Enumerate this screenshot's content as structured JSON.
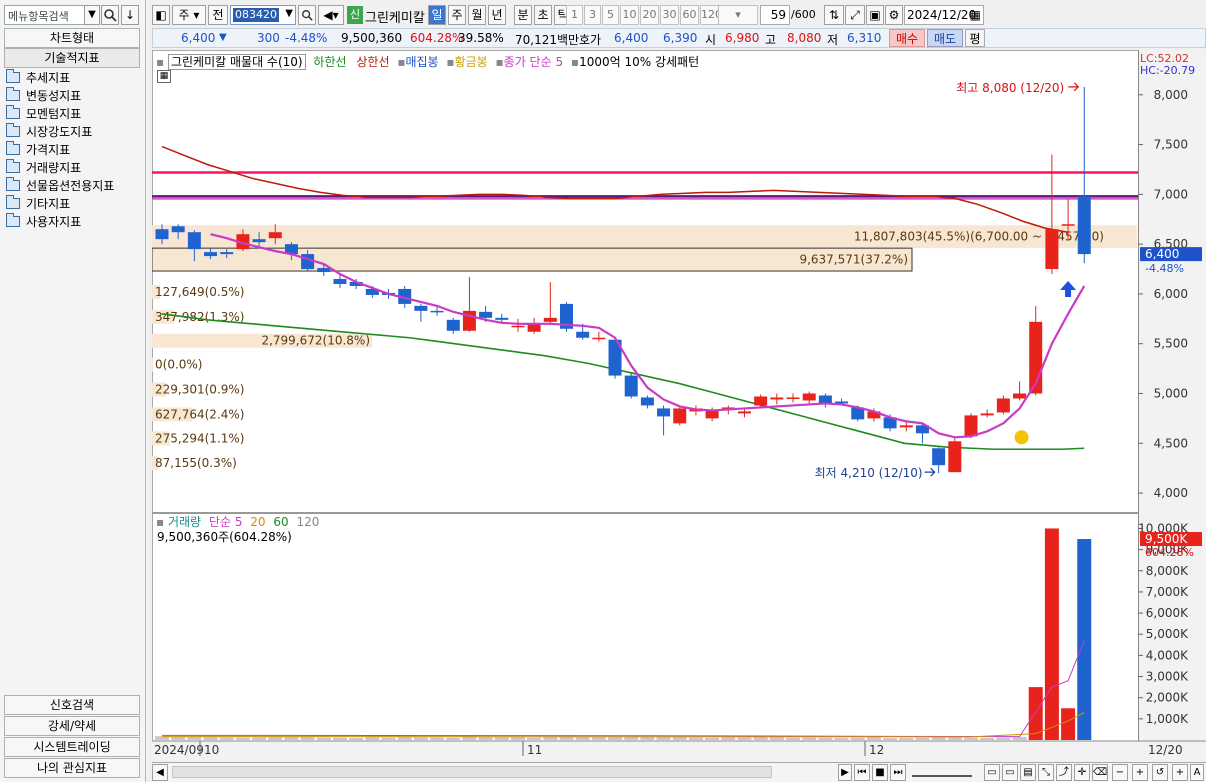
{
  "left_panel": {
    "search_placeholder": "메뉴항목검색",
    "chart_type_label": "차트형태",
    "tech_indicator_label": "기술적지표",
    "tree": [
      "추세지표",
      "변동성지표",
      "모멘텀지표",
      "시장강도지표",
      "가격지표",
      "거래량지표",
      "선물옵션전용지표",
      "기타지표",
      "사용자지표"
    ],
    "bottom_buttons": [
      "신호검색",
      "강세/약세",
      "시스템트레이딩",
      "나의 관심지표"
    ]
  },
  "toolbar": {
    "mode_label": "주",
    "prev_label": "전",
    "code_value": "083420",
    "credit_badge": "신",
    "stock_name": "그린케미칼",
    "periods": [
      "일",
      "주",
      "월",
      "년",
      "분",
      "초",
      "틱"
    ],
    "active_period": "일",
    "intervals": [
      "1",
      "3",
      "5",
      "10",
      "20",
      "30",
      "60",
      "120"
    ],
    "count_value": "59",
    "count_total": "/600",
    "date_value": "2024/12/20"
  },
  "quote": {
    "price": "6,400",
    "change": "300",
    "change_pct": "-4.48%",
    "volume": "9,500,360",
    "volume_pct": "604.28%",
    "turnover": "39.58%",
    "amount": "70,121백만",
    "bid_label": "호가",
    "ask": "6,400",
    "bid": "6,390",
    "open_label": "시",
    "open": "6,980",
    "high_label": "고",
    "high": "8,080",
    "low_label": "저",
    "low": "6,310",
    "buy_label": "매수",
    "sell_label": "매도",
    "avg_label": "평"
  },
  "price_legend": {
    "item1": "그린케미칼 매물대 수(10)",
    "item2": "하한선",
    "item3": "상한선",
    "item4": "매집봉",
    "item5": "황금봉",
    "item6": "종가 단순 5",
    "item7": "1000억 10% 강세패턴"
  },
  "lc_hc": {
    "lc": "LC:52.02",
    "hc": "HC:-20.79"
  },
  "volume_profile": [
    "11,807,803(45.5%)(6,700.00 ~ 6,457.50)",
    "9,637,571(37.2%)",
    "127,649(0.5%)",
    "347,982(1.3%)",
    "2,799,672(10.8%)",
    "0(0.0%)",
    "229,301(0.9%)",
    "627,764(2.4%)",
    "275,294(1.1%)",
    "87,155(0.3%)"
  ],
  "annotations": {
    "high": "최고 8,080 (12/20)",
    "low": "최저 4,210 (12/10)",
    "current_price": "6,400",
    "current_pct": "-4.48%"
  },
  "volume_legend": {
    "title": "거래량",
    "ma_label": "단순 5",
    "ma20": "20",
    "ma60": "60",
    "ma120": "120",
    "value_text": "9,500,360주(604.28%)",
    "current_value": "9,500K",
    "current_pct": "604.28%"
  },
  "xaxis": {
    "left_label": "2024/09",
    "m10": "10",
    "m11": "11",
    "m12": "12",
    "right_label": "12/20"
  },
  "colors": {
    "up": "#e8231b",
    "down": "#1f63cf",
    "ma5": "#c83ac8",
    "lower": "#1f8a1f",
    "upper": "#c0180a",
    "pink_line": "#ff1060",
    "purple_line": "#5a1878"
  },
  "chart_data": {
    "type": "candlestick",
    "y_ticks": [
      "8,000",
      "7,500",
      "7,000",
      "6,500",
      "6,000",
      "5,500",
      "5,000",
      "4,500",
      "4,000"
    ],
    "ylim": [
      3850,
      8450
    ],
    "vol_ticks": [
      "10,000K",
      "9,000K",
      "8,000K",
      "7,000K",
      "6,000K",
      "5,000K",
      "4,000K",
      "3,000K",
      "2,000K",
      "1,000K"
    ],
    "vol_lim": [
      0,
      10400
    ],
    "candles": [
      [
        6650,
        6550,
        6700,
        6500
      ],
      [
        6680,
        6620,
        6700,
        6550
      ],
      [
        6620,
        6450,
        6640,
        6330
      ],
      [
        6420,
        6380,
        6460,
        6350
      ],
      [
        6420,
        6400,
        6450,
        6360
      ],
      [
        6450,
        6600,
        6650,
        6430
      ],
      [
        6550,
        6520,
        6620,
        6470
      ],
      [
        6560,
        6620,
        6700,
        6500
      ],
      [
        6500,
        6400,
        6520,
        6340
      ],
      [
        6400,
        6250,
        6440,
        6230
      ],
      [
        6260,
        6220,
        6300,
        6180
      ],
      [
        6150,
        6100,
        6200,
        6060
      ],
      [
        6120,
        6080,
        6150,
        6050
      ],
      [
        6050,
        5990,
        6080,
        5960
      ],
      [
        6010,
        5990,
        6050,
        5950
      ],
      [
        6050,
        5900,
        6080,
        5860
      ],
      [
        5880,
        5830,
        5900,
        5720
      ],
      [
        5830,
        5820,
        5880,
        5780
      ],
      [
        5740,
        5630,
        5760,
        5600
      ],
      [
        5630,
        5830,
        6170,
        5620
      ],
      [
        5820,
        5760,
        5880,
        5720
      ],
      [
        5760,
        5740,
        5800,
        5700
      ],
      [
        5670,
        5680,
        5750,
        5620
      ],
      [
        5620,
        5700,
        5760,
        5600
      ],
      [
        5720,
        5760,
        6120,
        5700
      ],
      [
        5900,
        5650,
        5920,
        5620
      ],
      [
        5620,
        5560,
        5700,
        5540
      ],
      [
        5560,
        5560,
        5620,
        5520
      ],
      [
        5540,
        5180,
        5560,
        5150
      ],
      [
        5180,
        4970,
        5200,
        4950
      ],
      [
        4960,
        4880,
        4980,
        4850
      ],
      [
        4850,
        4770,
        4880,
        4580
      ],
      [
        4700,
        4850,
        4880,
        4680
      ],
      [
        4820,
        4850,
        4880,
        4780
      ],
      [
        4750,
        4830,
        4860,
        4720
      ],
      [
        4850,
        4860,
        4880,
        4790
      ],
      [
        4800,
        4820,
        4840,
        4760
      ],
      [
        4880,
        4970,
        4990,
        4850
      ],
      [
        4940,
        4960,
        5000,
        4890
      ],
      [
        4960,
        4960,
        5000,
        4910
      ],
      [
        4930,
        5000,
        5020,
        4900
      ],
      [
        4980,
        4900,
        5000,
        4860
      ],
      [
        4920,
        4900,
        4950,
        4880
      ],
      [
        4860,
        4740,
        4880,
        4720
      ],
      [
        4750,
        4820,
        4850,
        4720
      ],
      [
        4760,
        4650,
        4790,
        4620
      ],
      [
        4660,
        4680,
        4720,
        4620
      ],
      [
        4680,
        4600,
        4700,
        4500
      ],
      [
        4450,
        4280,
        4460,
        4200
      ],
      [
        4210,
        4520,
        4560,
        4210
      ],
      [
        4570,
        4780,
        4800,
        4550
      ],
      [
        4780,
        4800,
        4840,
        4760
      ],
      [
        4810,
        4950,
        4980,
        4790
      ],
      [
        4950,
        5000,
        5120,
        4930
      ],
      [
        5000,
        5720,
        5880,
        4980
      ],
      [
        6250,
        6650,
        7400,
        6200
      ],
      [
        6700,
        6700,
        6950,
        6550
      ],
      [
        6980,
        6400,
        8080,
        6310
      ]
    ],
    "ma5": [
      6600,
      6560,
      6510,
      6470,
      6430,
      6400,
      6350,
      6300,
      6200,
      6120,
      6060,
      6000,
      5960,
      5920,
      5880,
      5820,
      5780,
      5740,
      5710,
      5700,
      5700,
      5700,
      5690,
      5680,
      5660,
      5560,
      5280,
      5060,
      4940,
      4870,
      4840,
      4830,
      4840,
      4850,
      4860,
      4870,
      4880,
      4890,
      4900,
      4890,
      4860,
      4820,
      4760,
      4720,
      4700,
      4600,
      4560,
      4570,
      4620,
      4700,
      4850,
      5100,
      5500,
      5800,
      6080
    ],
    "lower_line": [
      5800,
      5770,
      5740,
      5720,
      5700,
      5680,
      5660,
      5640,
      5620,
      5600,
      5580,
      5560,
      5530,
      5500,
      5470,
      5440,
      5410,
      5380,
      5340,
      5300,
      5250,
      5200,
      5150,
      5100,
      5040,
      4980,
      4920,
      4860,
      4800,
      4740,
      4680,
      4620,
      4560,
      4500,
      4480,
      4460,
      4450,
      4440,
      4440,
      4440,
      4440,
      4450
    ],
    "upper_line": [
      7480,
      7390,
      7300,
      7230,
      7160,
      7110,
      7060,
      7020,
      6990,
      6970,
      6970,
      6970,
      6980,
      6990,
      7000,
      7000,
      6990,
      6970,
      6960,
      6960,
      6960,
      6980,
      7000,
      7010,
      7020,
      7020,
      7030,
      7040,
      7030,
      7020,
      7010,
      7000,
      6990,
      6980,
      6980,
      6960,
      6900,
      6820,
      6730,
      6660,
      6620
    ],
    "pink_level": 7220,
    "purple_level": 6980,
    "volumes": [
      180,
      160,
      150,
      140,
      130,
      120,
      130,
      140,
      150,
      160,
      120,
      110,
      100,
      140,
      120,
      150,
      130,
      120,
      110,
      200,
      150,
      130,
      140,
      110,
      160,
      180,
      150,
      140,
      130,
      170,
      150,
      160,
      140,
      120,
      110,
      130,
      120,
      140,
      130,
      110,
      120,
      110,
      100,
      110,
      130,
      90,
      100,
      110,
      140,
      130,
      110,
      100,
      120,
      150,
      2500,
      10000,
      1500,
      9500
    ]
  }
}
